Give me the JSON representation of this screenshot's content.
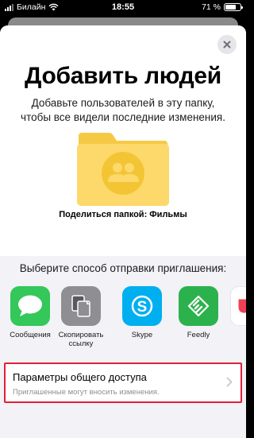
{
  "status_bar": {
    "carrier": "Билайн",
    "time": "18:55",
    "battery": "71 %",
    "battery_level": 0.71
  },
  "dialog": {
    "title": "Добавить людей",
    "subtitle": "Добавьте пользователей в эту папку, чтобы все видели последние изменения.",
    "folder_caption": "Поделиться папкой: Фильмы",
    "close_icon": "close-icon"
  },
  "share": {
    "prompt": "Выберите способ отправки приглашения:",
    "apps": [
      {
        "label": "Сообщения",
        "icon": "messages-icon",
        "color": "#34c759"
      },
      {
        "label": "Скопировать ссылку",
        "icon": "copy-icon",
        "color": "#8e8e93"
      },
      {
        "label": "Skype",
        "icon": "skype-icon",
        "color": "#00aff0"
      },
      {
        "label": "Feedly",
        "icon": "feedly-icon",
        "color": "#2bb24c"
      }
    ]
  },
  "options": {
    "title": "Параметры общего доступа",
    "subtitle": "Приглашенные могут вносить изменения."
  },
  "colors": {
    "folder": "#fcd96a",
    "highlight_border": "#e0203a"
  }
}
